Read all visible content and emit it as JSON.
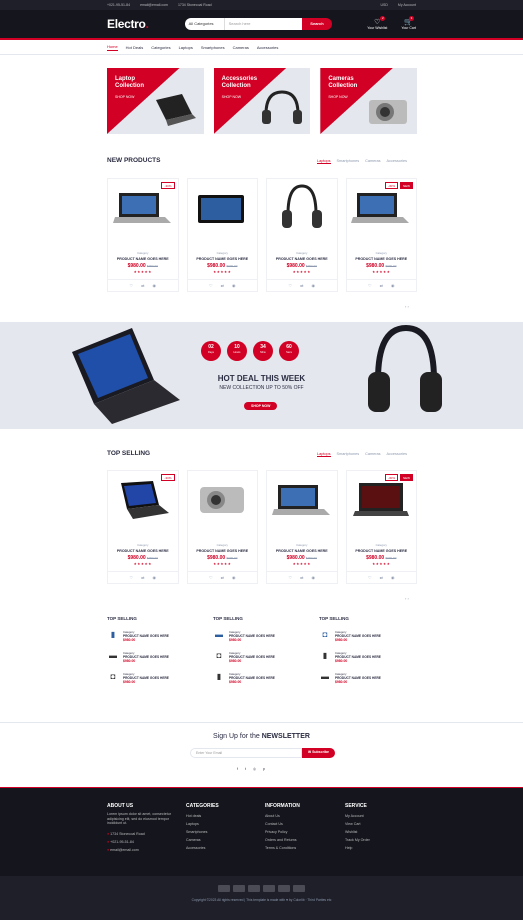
{
  "topbar": {
    "phone": "+021-95-51-84",
    "email": "email@email.com",
    "address": "1734 Stonecoal Road",
    "currency": "USD",
    "account": "My Account"
  },
  "header": {
    "logo": "Electro",
    "categories": "All Categories",
    "search_placeholder": "Search here",
    "search_btn": "Search",
    "wishlist": "Your Wishlist",
    "cart": "Your Cart",
    "wish_qty": "2",
    "cart_qty": "3"
  },
  "nav": [
    "Home",
    "Hot Deals",
    "Categories",
    "Laptops",
    "Smartphones",
    "Cameras",
    "Accessories"
  ],
  "collections": [
    {
      "title": "Laptop Collection",
      "link": "SHOP NOW"
    },
    {
      "title": "Accessories Collection",
      "link": "SHOP NOW"
    },
    {
      "title": "Cameras Collection",
      "link": "SHOP NOW"
    }
  ],
  "new_products": {
    "title": "NEW PRODUCTS",
    "tabs": [
      "Laptops",
      "Smartphones",
      "Cameras",
      "Accessories"
    ]
  },
  "top_selling": {
    "title": "TOP SELLING",
    "tabs": [
      "Laptops",
      "Smartphones",
      "Cameras",
      "Accessories"
    ]
  },
  "product": {
    "category": "Category",
    "name": "PRODUCT NAME GOES HERE",
    "price": "$980.00",
    "old": "$990.00",
    "stars": "★★★★★",
    "sale": "-30%",
    "new": "NEW"
  },
  "deal": {
    "days": "02",
    "hours": "10",
    "mins": "34",
    "secs": "60",
    "l_days": "Days",
    "l_hours": "Hours",
    "l_mins": "Mins",
    "l_secs": "Secs",
    "title": "HOT DEAL THIS WEEK",
    "subtitle": "NEW COLLECTION UP TO 50% OFF",
    "button": "SHOP NOW"
  },
  "mini_title": "TOP SELLING",
  "newsletter": {
    "pre": "Sign Up for the",
    "bold": "NEWSLETTER",
    "placeholder": "Enter Your Email",
    "button": "Subscribe"
  },
  "footer": {
    "about": {
      "h": "ABOUT US",
      "text": "Lorem ipsum dolor sit amet, consectetur adipisicing elit, sed do eiusmod tempor incididunt ut.",
      "addr": "1734 Stonecoal Road",
      "phone": "+021-95-51-84",
      "email": "email@email.com"
    },
    "categories": {
      "h": "CATEGORIES",
      "items": [
        "Hot deals",
        "Laptops",
        "Smartphones",
        "Cameras",
        "Accessories"
      ]
    },
    "information": {
      "h": "INFORMATION",
      "items": [
        "About Us",
        "Contact Us",
        "Privacy Policy",
        "Orders and Returns",
        "Terms & Conditions"
      ]
    },
    "service": {
      "h": "SERVICE",
      "items": [
        "My Account",
        "View Cart",
        "Wishlist",
        "Track My Order",
        "Help"
      ]
    }
  },
  "copyright": "Copyright ©2023 All rights reserved | This template is made with ♥ by Colorlib · Third Parties etc"
}
